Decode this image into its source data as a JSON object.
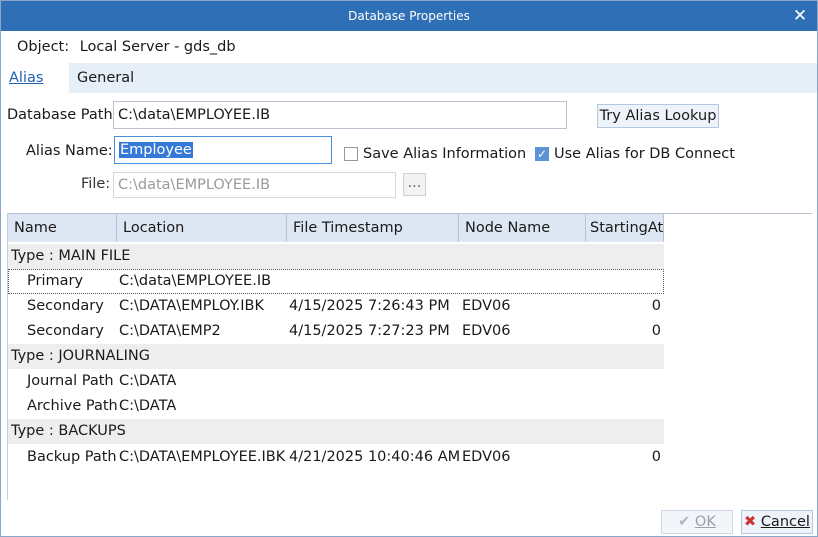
{
  "window": {
    "title": "Database Properties",
    "close_glyph": "✕"
  },
  "object": {
    "label": "Object:",
    "value": "Local Server - gds_db"
  },
  "tabs": [
    {
      "label": "Alias",
      "active": true
    },
    {
      "label": "General",
      "active": false
    }
  ],
  "form": {
    "db_path_label": "Database Path:",
    "db_path_value": "C:\\data\\EMPLOYEE.IB",
    "try_alias_label": "Try Alias Lookup",
    "alias_name_label": "Alias Name:",
    "alias_name_value": "Employee",
    "save_alias_label": "Save Alias Information",
    "save_alias_checked": false,
    "use_alias_label": "Use Alias for DB Connect",
    "use_alias_checked": true,
    "file_label": "File:",
    "file_value": "C:\\data\\EMPLOYEE.IB",
    "browse_label": "..."
  },
  "grid": {
    "columns": [
      "Name",
      "Location",
      "File Timestamp",
      "Node Name",
      "StartingAt"
    ],
    "groups": [
      {
        "label": "Type : MAIN FILE",
        "rows": [
          {
            "name": "Primary",
            "location": "C:\\data\\EMPLOYEE.IB",
            "timestamp": "",
            "node": "",
            "starting": ""
          },
          {
            "name": "Secondary",
            "location": "C:\\DATA\\EMPLOY.IBK",
            "timestamp": "4/15/2025 7:26:43 PM",
            "node": "EDV06",
            "starting": "0"
          },
          {
            "name": "Secondary",
            "location": "C:\\DATA\\EMP2",
            "timestamp": "4/15/2025 7:27:23 PM",
            "node": "EDV06",
            "starting": "0"
          }
        ]
      },
      {
        "label": "Type : JOURNALING",
        "rows": [
          {
            "name": "Journal Path",
            "location": "C:\\DATA",
            "timestamp": "",
            "node": "",
            "starting": ""
          },
          {
            "name": "Archive Path",
            "location": "C:\\DATA",
            "timestamp": "",
            "node": "",
            "starting": ""
          }
        ]
      },
      {
        "label": "Type : BACKUPS",
        "rows": [
          {
            "name": "Backup Path",
            "location": "C:\\DATA\\EMPLOYEE.IBK",
            "timestamp": "4/21/2025 10:40:46 AM",
            "node": "EDV06",
            "starting": "0"
          }
        ]
      }
    ]
  },
  "footer": {
    "ok_label": "OK",
    "cancel_label": "Cancel",
    "ok_glyph": "✔",
    "cancel_glyph": "✖"
  },
  "colors": {
    "titlebar": "#2f6fb5",
    "accent": "#1f5fae",
    "selection": "#3579d6",
    "cancel_icon": "#d03030"
  }
}
